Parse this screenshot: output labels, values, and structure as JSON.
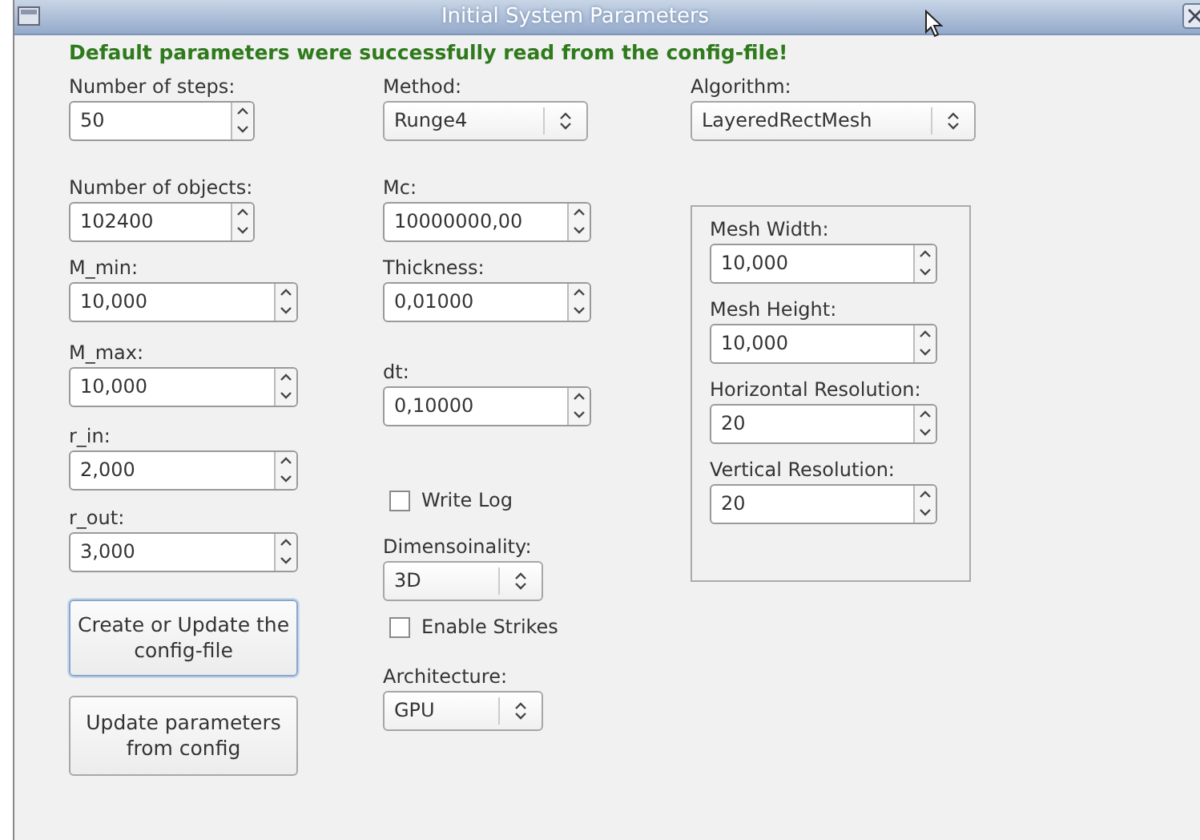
{
  "window": {
    "title": "Initial System Parameters"
  },
  "message": "Default parameters were successfully read from the config-file!",
  "columns": [
    {
      "items": [
        {
          "kind": "spin",
          "label": "Number of steps:",
          "value": "50"
        },
        {
          "kind": "spin",
          "label": "Number of objects:",
          "value": "102400"
        },
        {
          "kind": "spin",
          "label": "M_min:",
          "value": "10,000"
        },
        {
          "kind": "spin",
          "label": "M_max:",
          "value": "10,000"
        },
        {
          "kind": "spin",
          "label": "r_in:",
          "value": "2,000"
        },
        {
          "kind": "spin",
          "label": "r_out:",
          "value": "3,000"
        },
        {
          "kind": "button",
          "label": "Create or Update the config-file",
          "focused": true
        },
        {
          "kind": "button",
          "label": "Update parameters from config",
          "focused": false
        }
      ]
    },
    {
      "items": [
        {
          "kind": "combo",
          "label": "Method:",
          "value": "Runge4"
        },
        {
          "kind": "spin",
          "label": "Mc:",
          "value": "10000000,00"
        },
        {
          "kind": "spin",
          "label": "Thickness:",
          "value": "0,01000"
        },
        {
          "kind": "spin",
          "label": "dt:",
          "value": "0,10000"
        },
        {
          "kind": "checkbox",
          "label": "Write Log",
          "checked": false
        },
        {
          "kind": "combo",
          "label": "Dimensoinality:",
          "value": "3D"
        },
        {
          "kind": "checkbox",
          "label": "Enable Strikes",
          "checked": false
        },
        {
          "kind": "combo",
          "label": "Architecture:",
          "value": "GPU"
        }
      ]
    },
    {
      "items": [
        {
          "kind": "combo",
          "label": "Algorithm:",
          "value": "LayeredRectMesh"
        },
        {
          "kind": "group",
          "children": [
            {
              "kind": "spin",
              "label": "Mesh Width:",
              "value": "10,000"
            },
            {
              "kind": "spin",
              "label": "Mesh Height:",
              "value": "10,000"
            },
            {
              "kind": "spin",
              "label": "Horizontal Resolution:",
              "value": "20"
            },
            {
              "kind": "spin",
              "label": "Vertical Resolution:",
              "value": "20"
            }
          ]
        }
      ]
    }
  ]
}
